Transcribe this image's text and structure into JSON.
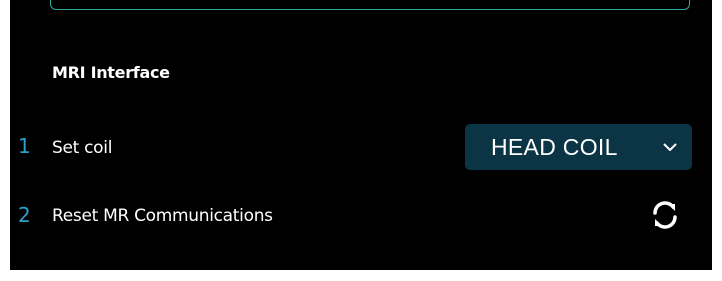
{
  "section": {
    "title": "MRI Interface"
  },
  "rows": [
    {
      "number": "1",
      "label": "Set coil",
      "control": {
        "type": "select",
        "value": "HEAD COIL",
        "icon": "chevron-down-icon"
      }
    },
    {
      "number": "2",
      "label": "Reset MR Communications",
      "control": {
        "type": "button",
        "icon": "refresh-icon"
      }
    }
  ],
  "colors": {
    "background": "#000000",
    "accent": "#2aa1cc",
    "select_background": "#0b3544",
    "text": "#ffffff"
  }
}
